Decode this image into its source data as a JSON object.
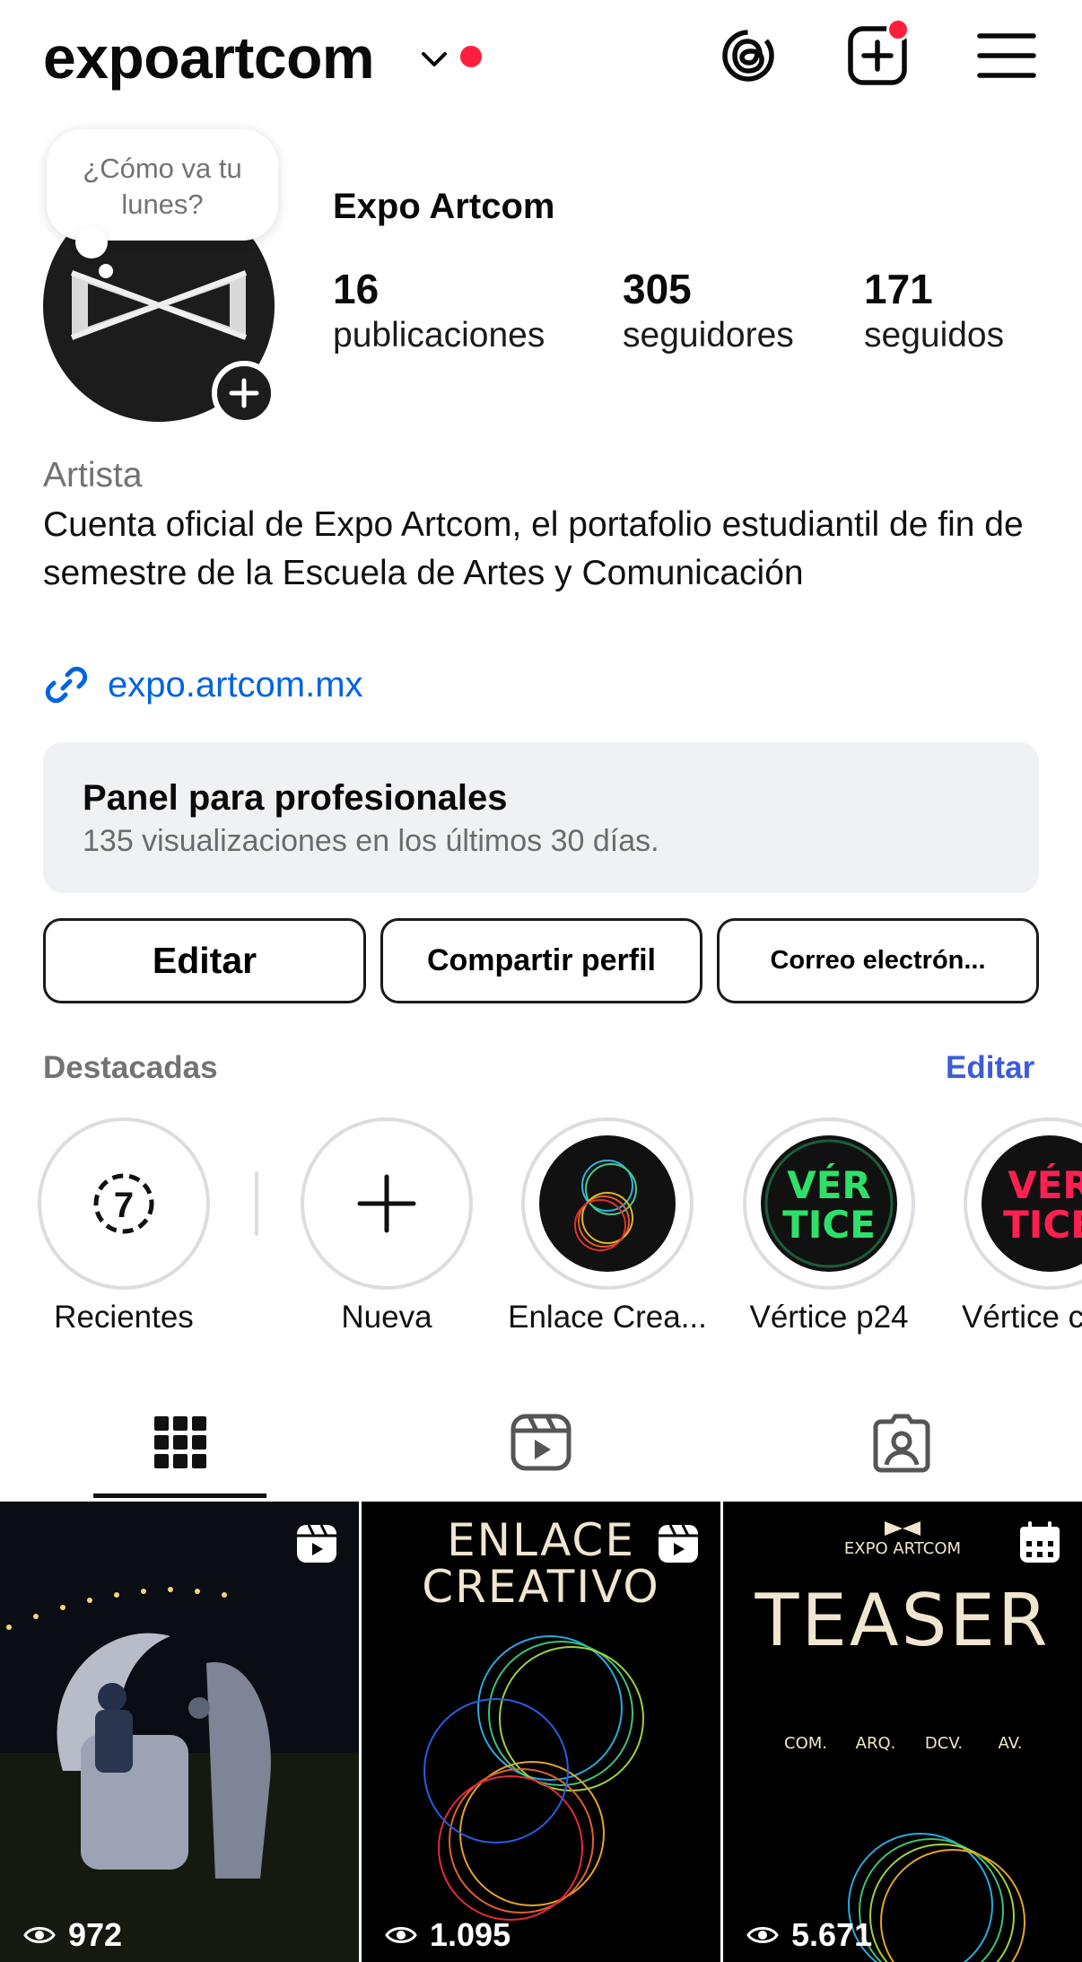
{
  "header": {
    "username": "expoartcom",
    "notification_color": "#ff1f3d",
    "icons": [
      "chevron-down-icon",
      "threads-icon",
      "new-post-icon",
      "menu-icon"
    ]
  },
  "profile": {
    "note": "¿Cómo va tu lunes?",
    "display_name": "Expo Artcom",
    "stats": [
      {
        "value": "16",
        "label": "publicaciones"
      },
      {
        "value": "305",
        "label": "seguidores"
      },
      {
        "value": "171",
        "label": "seguidos"
      }
    ],
    "category": "Artista",
    "bio": "Cuenta oficial de Expo Artcom, el portafolio estudiantil de fin de semestre de la Escuela de Artes y Comunicación",
    "link": "expo.artcom.mx",
    "link_color": "#0064e0"
  },
  "pro_panel": {
    "title": "Panel para profesionales",
    "subtitle": "135 visualizaciones en los últimos 30 días."
  },
  "buttons": {
    "edit": "Editar",
    "share": "Compartir perfil",
    "mail": "Correo electrón..."
  },
  "highlights": {
    "title": "Destacadas",
    "edit": "Editar",
    "recent_count": "7",
    "items": [
      {
        "label": "Recientes"
      },
      {
        "label": "Nueva"
      },
      {
        "label": "Enlace Crea..."
      },
      {
        "label": "Vértice p24"
      },
      {
        "label": "Vértice c"
      }
    ]
  },
  "tabs": [
    "grid-icon",
    "reels-icon",
    "tagged-icon"
  ],
  "grid": [
    {
      "views": "972",
      "badge": "reel-icon"
    },
    {
      "views": "1.095",
      "badge": "reel-icon",
      "text_line1": "ENLACE",
      "text_line2": "CREATIVO"
    },
    {
      "views": "5.671",
      "badge": "calendar-icon",
      "brand": "EXPO ARTCOM",
      "title": "TEASER",
      "tags": [
        "COM.",
        "ARQ.",
        "DCV.",
        "AV."
      ]
    }
  ]
}
